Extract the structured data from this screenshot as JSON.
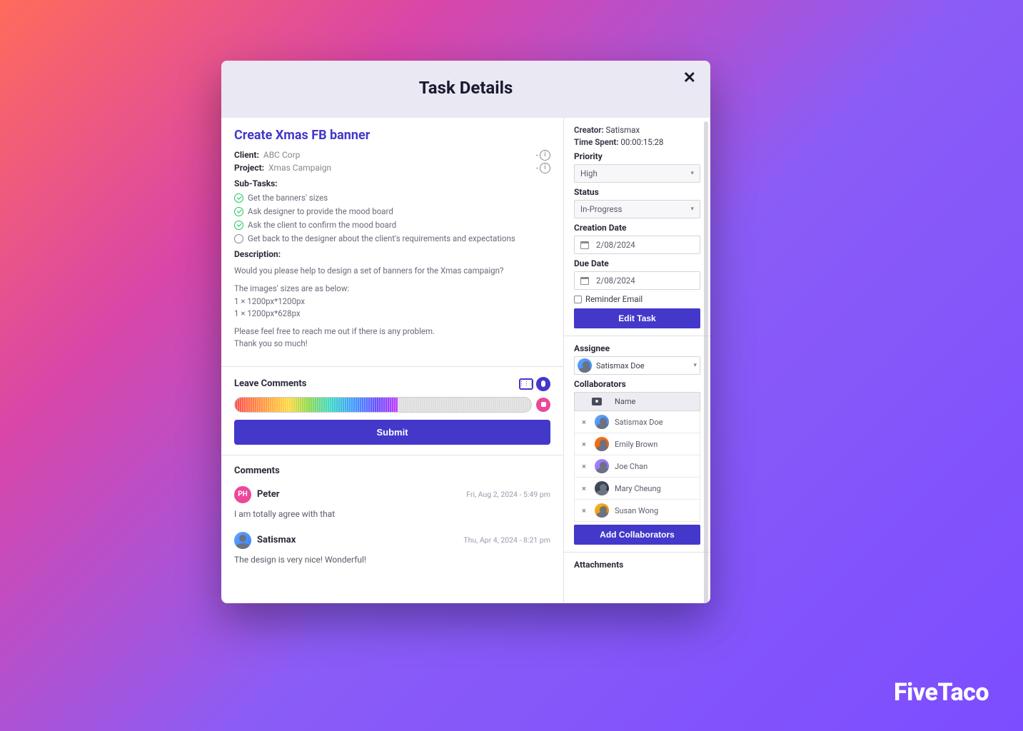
{
  "brand": "FiveTaco",
  "modal": {
    "title": "Task Details",
    "task_title": "Create Xmas FB banner",
    "client_label": "Client:",
    "client_value": "ABC Corp",
    "project_label": "Project:",
    "project_value": "Xmas Campaign",
    "subtasks_label": "Sub-Tasks:",
    "subtasks": [
      {
        "text": "Get the banners' sizes",
        "done": true
      },
      {
        "text": "Ask designer to provide the mood board",
        "done": true
      },
      {
        "text": "Ask the client to confirm the mood board",
        "done": true
      },
      {
        "text": "Get back to the designer about the client's requirements and expectations",
        "done": false
      }
    ],
    "description_label": "Description:",
    "description": {
      "p1": "Would you please help to design a set of banners for the Xmas campaign?",
      "p2": "The images' sizes are as below:",
      "l1": "1 × 1200px*1200px",
      "l2": "1 × 1200px*628px",
      "p3": "Please feel free to reach me out if there is any problem.",
      "p4": "Thank you so much!"
    },
    "leave_comments_label": "Leave Comments",
    "submit_label": "Submit",
    "comments_title": "Comments",
    "comments": [
      {
        "initials": "PH",
        "name": "Peter",
        "date": "Fri, Aug 2, 2024 - 5:49 pm",
        "text": "I am totally agree with that"
      },
      {
        "initials": "",
        "name": "Satismax",
        "date": "Thu, Apr 4, 2024 - 8:21 pm",
        "text": "The design is very nice! Wonderful!"
      }
    ]
  },
  "side": {
    "creator_label": "Creator:",
    "creator_value": "Satismax",
    "time_label": "Time Spent:",
    "time_value": "00:00:15:28",
    "priority_label": "Priority",
    "priority_value": "High",
    "status_label": "Status",
    "status_value": "In-Progress",
    "creation_label": "Creation Date",
    "creation_value": "2/08/2024",
    "due_label": "Due Date",
    "due_value": "2/08/2024",
    "reminder_label": "Reminder Email",
    "edit_label": "Edit Task",
    "assignee_label": "Assignee",
    "assignee_value": "Satismax Doe",
    "collaborators_label": "Collaborators",
    "name_col": "Name",
    "collaborators": [
      "Satismax Doe",
      "Emily Brown",
      "Joe Chan",
      "Mary Cheung",
      "Susan Wong"
    ],
    "add_collab_label": "Add Collaborators",
    "attachments_label": "Attachments"
  }
}
